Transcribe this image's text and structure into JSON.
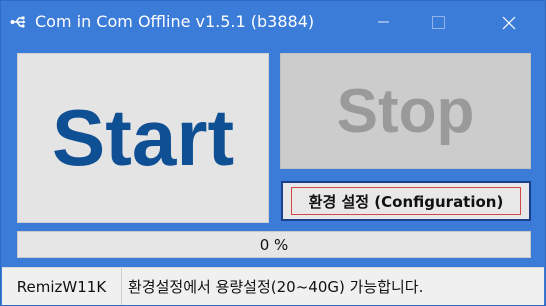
{
  "window": {
    "title": "Com in Com Offline v1.5.1 (b3884)",
    "app_icon": "usb-icon",
    "controls": [
      "minimize-icon",
      "maximize-icon",
      "close-icon"
    ]
  },
  "main": {
    "start_label": "Start",
    "stop_label": "Stop",
    "config_label": "환경 설정 (Configuration)"
  },
  "progress": {
    "value": 0,
    "text": "0 %"
  },
  "status": {
    "host": "RemizW11K",
    "message": "환경설정에서 용량설정(20~40G) 가능합니다."
  },
  "colors": {
    "titlebar": "#3a7cd8",
    "start_text": "#0f4f93",
    "stop_text": "#9a9a9a",
    "config_border": "#1b3f8a",
    "config_focus": "#d04848"
  }
}
